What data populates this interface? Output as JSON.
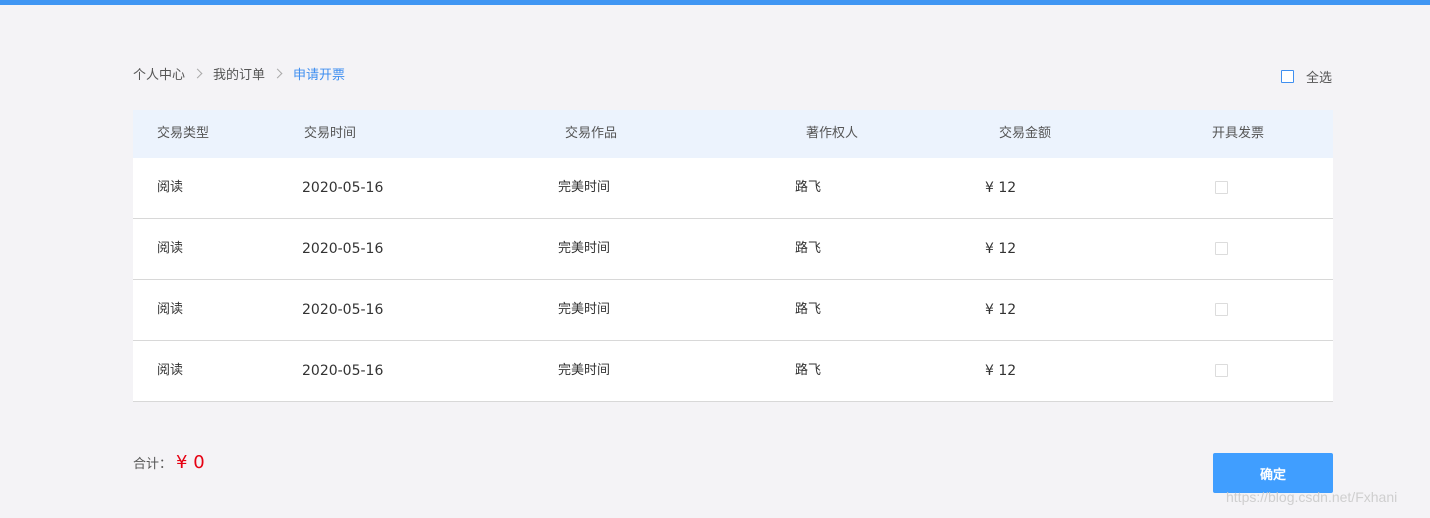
{
  "colors": {
    "accent": "#409eff",
    "top_bar": "#4096f3",
    "amount_red": "#e60012",
    "header_bg": "#ecf3fd",
    "page_bg": "#f4f3f6"
  },
  "breadcrumb": {
    "items": [
      "个人中心",
      "我的订单",
      "申请开票"
    ]
  },
  "select_all": {
    "label": "全选",
    "checked": false
  },
  "table": {
    "headers": {
      "type": "交易类型",
      "time": "交易时间",
      "work": "交易作品",
      "author": "著作权人",
      "amount": "交易金额",
      "invoice": "开具发票"
    },
    "rows": [
      {
        "type": "阅读",
        "time": "2020-05-16",
        "work": "完美时间",
        "author": "路飞",
        "amount": "¥ 12",
        "invoice": false
      },
      {
        "type": "阅读",
        "time": "2020-05-16",
        "work": "完美时间",
        "author": "路飞",
        "amount": "¥ 12",
        "invoice": false
      },
      {
        "type": "阅读",
        "time": "2020-05-16",
        "work": "完美时间",
        "author": "路飞",
        "amount": "¥ 12",
        "invoice": false
      },
      {
        "type": "阅读",
        "time": "2020-05-16",
        "work": "完美时间",
        "author": "路飞",
        "amount": "¥ 12",
        "invoice": false
      }
    ]
  },
  "footer": {
    "total_label": "合计：",
    "total_value": "¥ 0",
    "confirm_label": "确定"
  },
  "watermark": "https://blog.csdn.net/Fxhani"
}
